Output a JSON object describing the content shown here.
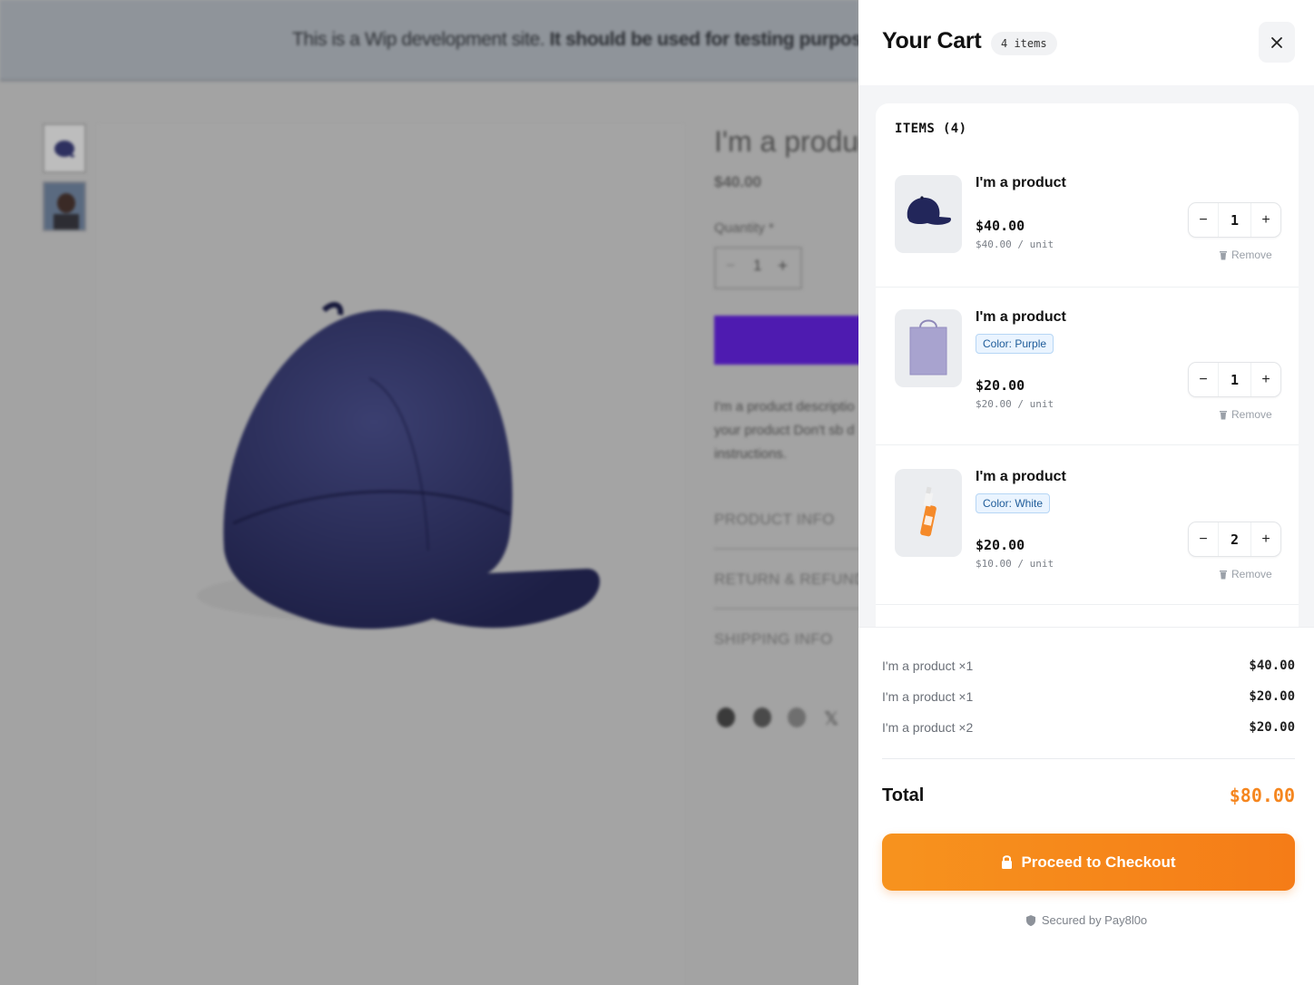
{
  "background_page": {
    "banner_text_regular": "This is a Wip development site.",
    "banner_text_bold": "It should be used for testing purposes",
    "product_title": "I'm a produc",
    "product_price": "$40.00",
    "quantity_label": "Quantity *",
    "quantity_value": "1",
    "description_lines": [
      "I'm a product descriptio",
      "your product Don't sb d",
      "instructions."
    ],
    "accordions": [
      "PRODUCT INFO",
      "RETURN & REFUND",
      "SHIPPING INFO"
    ]
  },
  "cart": {
    "title": "Your Cart",
    "count_badge": "4 items",
    "items_heading": "ITEMS (4)",
    "items": [
      {
        "name": "I'm a product",
        "variant": "",
        "price": "$40.00",
        "unit_price": "$40.00 / unit",
        "quantity": "1",
        "remove_label": "Remove",
        "image": "navy-cap"
      },
      {
        "name": "I'm a product",
        "variant": "Color: Purple",
        "price": "$20.00",
        "unit_price": "$20.00 / unit",
        "quantity": "1",
        "remove_label": "Remove",
        "image": "purple-tote-bag"
      },
      {
        "name": "I'm a product",
        "variant": "Color: White",
        "price": "$20.00",
        "unit_price": "$10.00 / unit",
        "quantity": "2",
        "remove_label": "Remove",
        "image": "orange-spray-bottle"
      }
    ],
    "summary_lines": [
      {
        "label": "I'm a product ×1",
        "value": "$40.00"
      },
      {
        "label": "I'm a product ×1",
        "value": "$20.00"
      },
      {
        "label": "I'm a product ×2",
        "value": "$20.00"
      }
    ],
    "total_label": "Total",
    "total_value": "$80.00",
    "checkout_label": "Proceed to Checkout",
    "secured_label": "Secured by Pay8l0o",
    "colors": {
      "accent": "#f5861f",
      "variant_tag_bg": "#eaf4ff",
      "variant_tag_text": "#1f5c99"
    }
  }
}
